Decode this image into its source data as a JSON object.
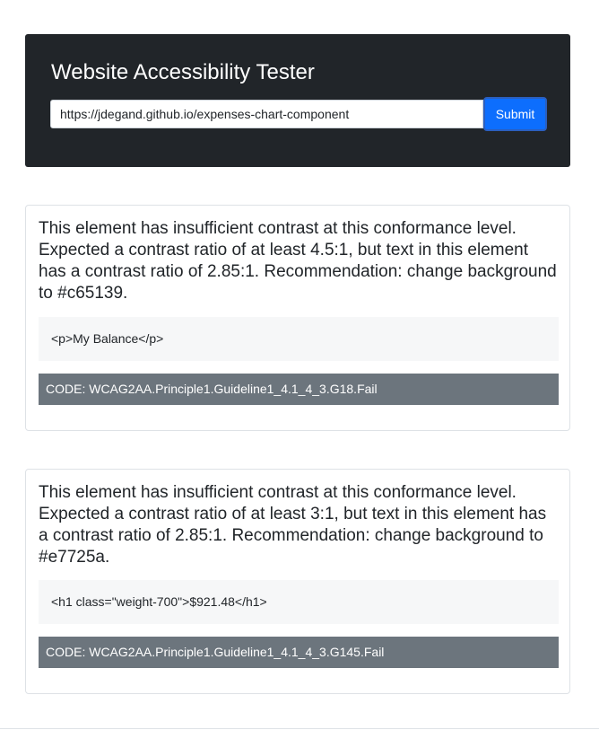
{
  "header": {
    "title": "Website Accessibility Tester",
    "url_value": "https://jdegand.github.io/expenses-chart-component",
    "submit_label": "Submit"
  },
  "results": [
    {
      "message": "This element has insufficient contrast at this conformance level. Expected a contrast ratio of at least 4.5:1, but text in this element has a contrast ratio of 2.85:1. Recommendation: change background to #c65139.",
      "snippet": "<p>My Balance</p>",
      "code": "CODE: WCAG2AA.Principle1.Guideline1_4.1_4_3.G18.Fail"
    },
    {
      "message": "This element has insufficient contrast at this conformance level. Expected a contrast ratio of at least 3:1, but text in this element has a contrast ratio of 2.85:1. Recommendation: change background to #e7725a.",
      "snippet": "<h1 class=\"weight-700\">$921.48</h1>",
      "code": "CODE: WCAG2AA.Principle1.Guideline1_4.1_4_3.G145.Fail"
    }
  ],
  "colors": {
    "header_bg": "#212529",
    "submit_bg": "#0d6efd",
    "code_bg": "#6c757d",
    "snippet_bg": "#f6f7f8"
  }
}
